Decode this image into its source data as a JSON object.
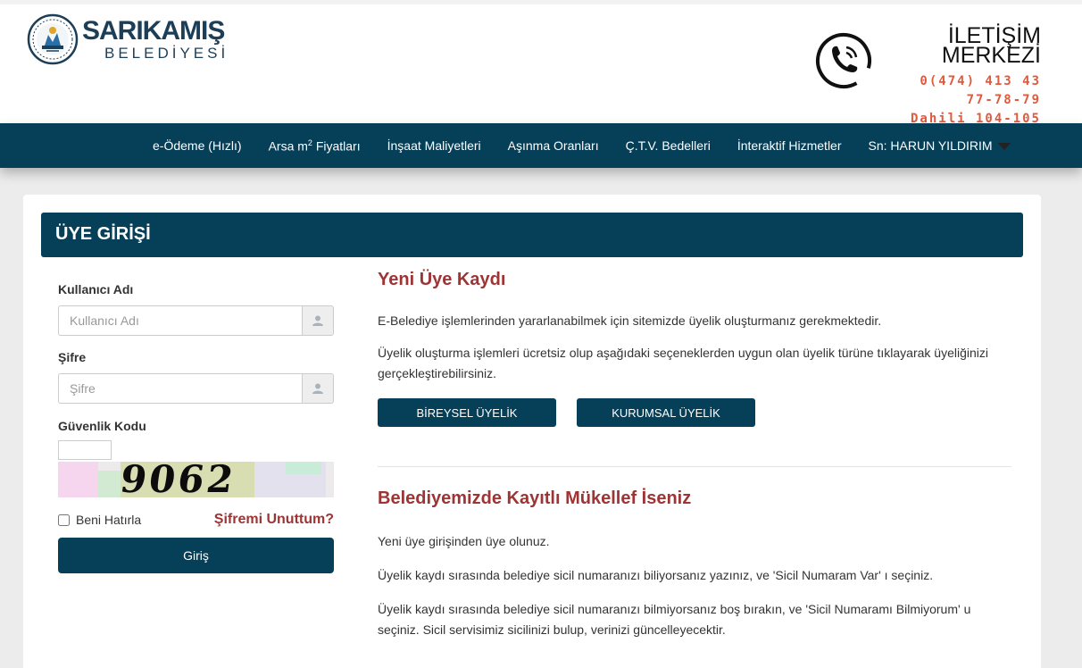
{
  "brand": {
    "name": "SARIKAMIŞ",
    "subtitle": "BELEDİYESİ"
  },
  "contact": {
    "title_line1": "İLETİŞİM",
    "title_line2": "MERKEZİ",
    "phone_line1": "0(474) 413 43",
    "phone_line2": "77-78-79",
    "phone_line3": "Dahili 104-105"
  },
  "nav": {
    "items": [
      "e-Ödeme (Hızlı)",
      "Arsa m",
      "İnşaat Maliyetleri",
      "Aşınma Oranları",
      "Ç.T.V. Bedelleri",
      "İnteraktif Hizmetler"
    ],
    "arsa_sup": "2",
    "arsa_suffix": " Fiyatları",
    "user": "Sn: HARUN YILDIRIM"
  },
  "page": {
    "title": "ÜYE GİRİŞİ"
  },
  "login": {
    "username_label": "Kullanıcı Adı",
    "username_placeholder": "Kullanıcı Adı",
    "password_label": "Şifre",
    "password_placeholder": "Şifre",
    "captcha_label": "Güvenlik Kodu",
    "captcha_code": "9062",
    "remember_label": "Beni Hatırla",
    "forgot_label": "Şifremi Unuttum?",
    "login_button": "Giriş"
  },
  "register": {
    "title": "Yeni Üye Kaydı",
    "para1": "E-Belediye işlemlerinden yararlanabilmek için sitemizde üyelik oluşturmanız gerekmektedir.",
    "para2": "Üyelik oluşturma işlemleri ücretsiz olup aşağıdaki seçeneklerden uygun olan üyelik türüne tıklayarak üyeliğinizi gerçekleştirebilirsiniz.",
    "individual_button": "BİREYSEL ÜYELİK",
    "corporate_button": "KURUMSAL ÜYELİK"
  },
  "taxpayer": {
    "title": "Belediyemizde Kayıtlı Mükellef İseniz",
    "para1": "Yeni üye girişinden üye olunuz.",
    "para2": "Üyelik kaydı sırasında belediye sicil numaranızı biliyorsanız yazınız, ve 'Sicil Numaram Var' ı seçiniz.",
    "para3": "Üyelik kaydı sırasında belediye sicil numaranızı bilmiyorsanız boş bırakın, ve 'Sicil Numaramı Bilmiyorum' u seçiniz. Sicil servisimiz sicilinizi bulup, verinizi güncelleyecektir."
  },
  "colors": {
    "primary": "#063f58",
    "accent_red": "#9e3434",
    "phone_orange": "#e05a3e"
  }
}
